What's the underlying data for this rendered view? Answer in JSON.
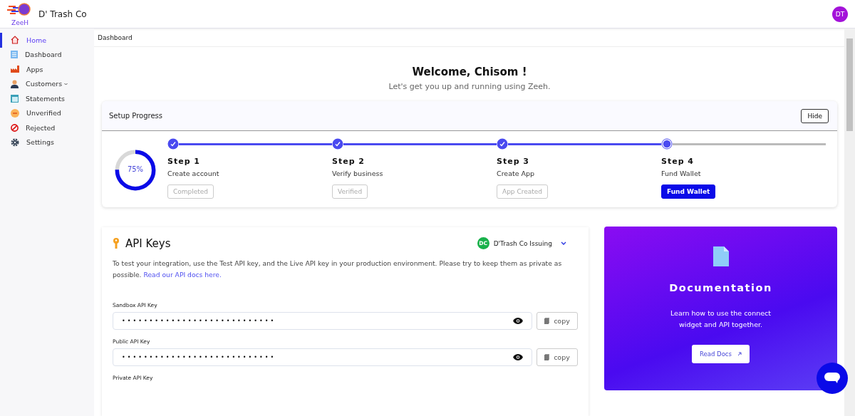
{
  "header": {
    "logo_text": "ZeeH",
    "company": "D' Trash Co",
    "avatar": "DT"
  },
  "sidebar": {
    "items": [
      {
        "label": "Home",
        "selected": true
      },
      {
        "label": "Dashboard",
        "selected": false
      },
      {
        "label": "Apps",
        "selected": false
      },
      {
        "label": "Customers",
        "selected": false,
        "expandable": true
      },
      {
        "label": "Statements",
        "selected": false
      },
      {
        "label": "Unverified",
        "selected": false
      },
      {
        "label": "Rejected",
        "selected": false
      },
      {
        "label": "Settings",
        "selected": false
      }
    ]
  },
  "breadcrumb": "Dashboard",
  "welcome": {
    "title": "Welcome, Chisom !",
    "subtitle": "Let's get you up and running using Zeeh."
  },
  "setup": {
    "title": "Setup Progress",
    "hide": "Hide",
    "progress": {
      "level": 0.75,
      "reading": "75%"
    },
    "steps": [
      {
        "step": "Step 1",
        "name": "Create account",
        "status": "Completed",
        "completed": true
      },
      {
        "step": "Step 2",
        "name": "Verify business",
        "status": "Verified",
        "completed": true
      },
      {
        "step": "Step 3",
        "name": "Create App",
        "status": "App Created",
        "completed": true
      },
      {
        "step": "Step 4",
        "name": "Fund Wallet",
        "status": "Fund Wallet",
        "completed": false
      }
    ]
  },
  "api_keys": {
    "title": "API Keys",
    "account": {
      "initials": "DC",
      "name": "D'Trash Co Issuing"
    },
    "description": "To test your integration, use the Test API key, and the Live API key in your production environment. Please try to keep them as private as possible.",
    "docs_link": "Read our API docs here.",
    "keys": [
      {
        "label": "Sandbox API Key",
        "value": "••••••••••••••••••••••••••••",
        "copy": "copy"
      },
      {
        "label": "Public API Key",
        "value": "••••••••••••••••••••••••••••",
        "copy": "copy"
      },
      {
        "label": "Private API Key"
      }
    ]
  },
  "documentation": {
    "title": "Documentation",
    "text": "Learn how to use the connect widget and API together.",
    "button": "Read Docs"
  }
}
